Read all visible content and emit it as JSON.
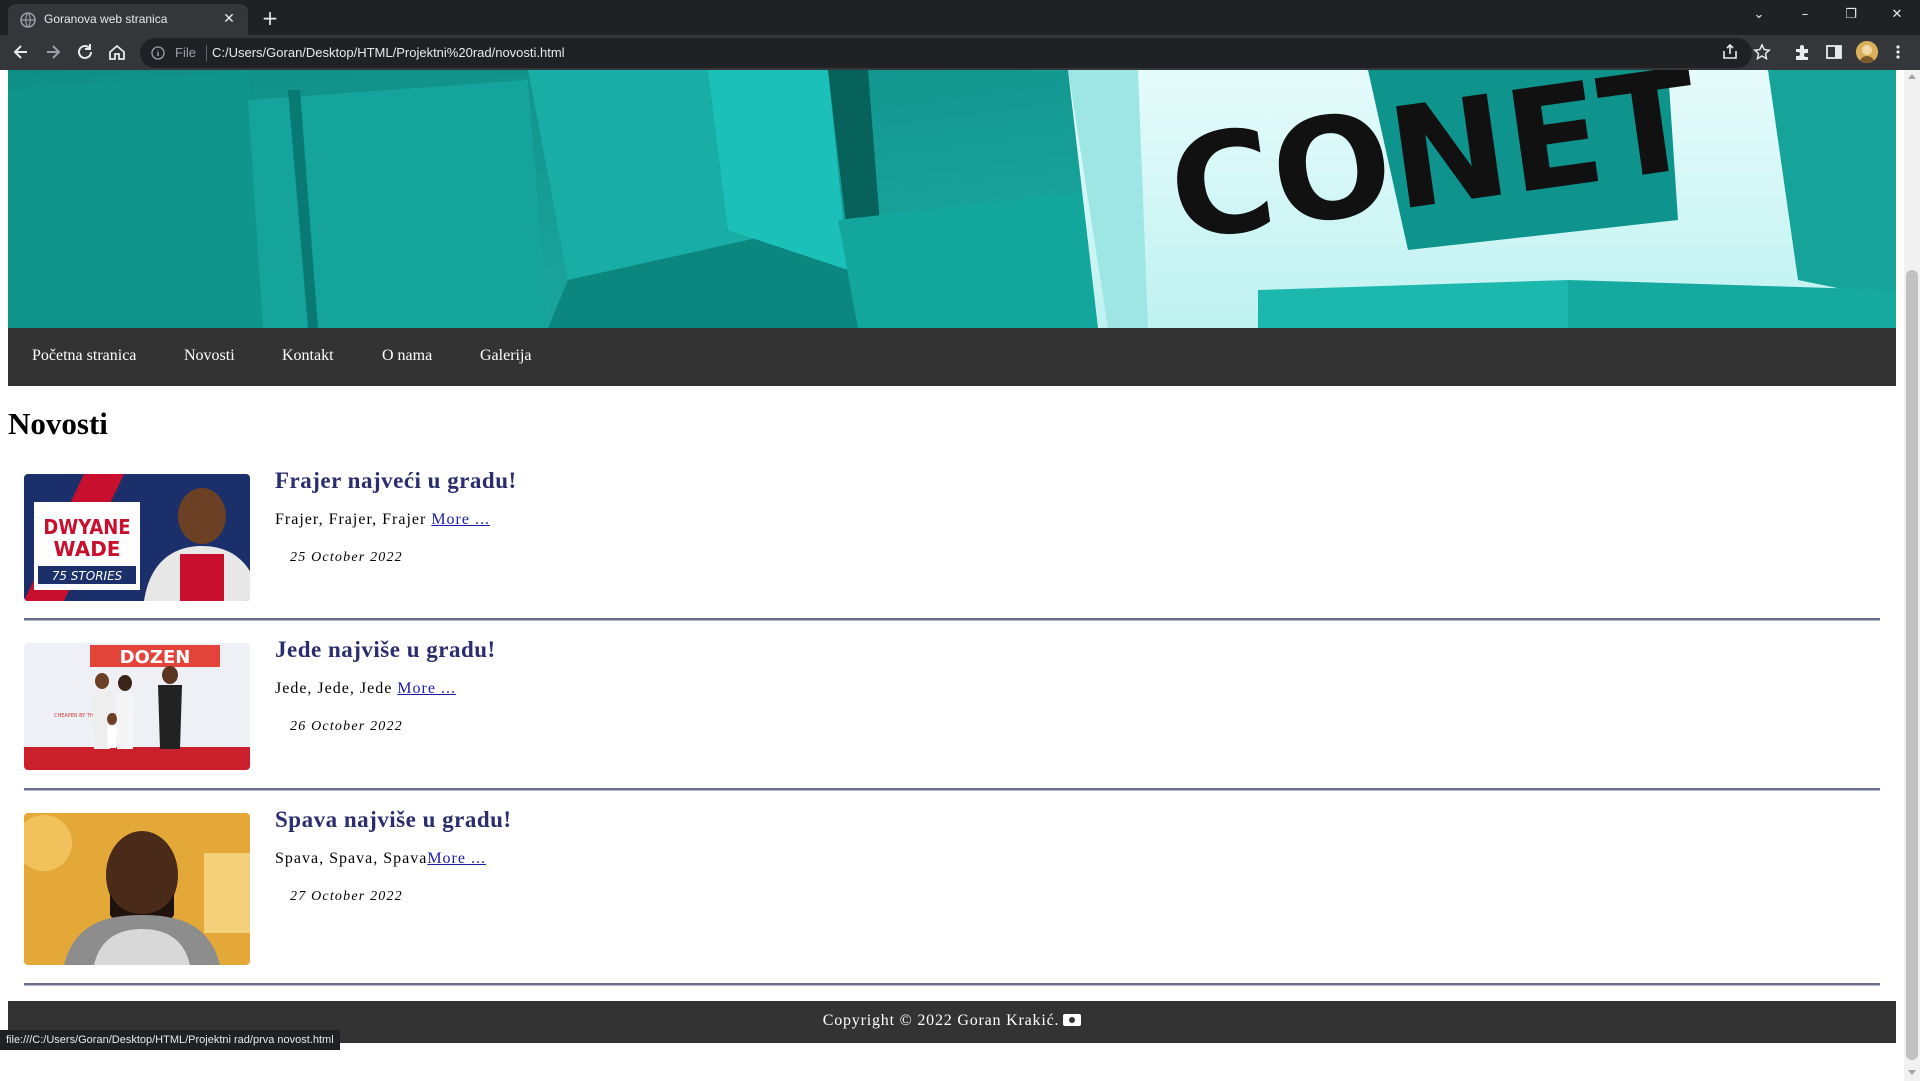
{
  "browser": {
    "tab_title": "Goranova web stranica",
    "omnibox_scheme": "File",
    "url": "C:/Users/Goran/Desktop/HTML/Projektni%20rad/novosti.html",
    "status_url": "file:///C:/Users/Goran/Desktop/HTML/Projektni rad/prva novost.html"
  },
  "banner": {
    "logo_text": "CONET"
  },
  "nav": {
    "items": [
      {
        "label": "Početna stranica"
      },
      {
        "label": "Novosti"
      },
      {
        "label": "Kontakt"
      },
      {
        "label": "O nama"
      },
      {
        "label": "Galerija"
      }
    ]
  },
  "page": {
    "heading": "Novosti"
  },
  "articles": [
    {
      "title": "Frajer najveći u gradu!",
      "text": "Frajer, Frajer, Frajer ",
      "more": "More ...",
      "date": "25 October 2022",
      "image_caption": {
        "line1": "DWYANE",
        "line2": "WADE",
        "line3": "75 STORIES"
      }
    },
    {
      "title": "Jede najviše u gradu!",
      "text": "Jede, Jede, Jede ",
      "more": "More ...",
      "date": "26 October 2022",
      "image_caption": {
        "line1": "DOZEN",
        "line2": "CHEAPER BY THE DOZEN"
      }
    },
    {
      "title": "Spava najviše u gradu!",
      "text": "Spava, Spava, Spava",
      "more": "More ...",
      "date": "27 October 2022"
    }
  ],
  "footer": {
    "text": "Copyright © 2022 Goran Krakić."
  },
  "colors": {
    "nav_bg": "#333333",
    "title": "#2a2d6e",
    "link": "#1a1aa6",
    "banner_teal": "#1aa39b"
  }
}
